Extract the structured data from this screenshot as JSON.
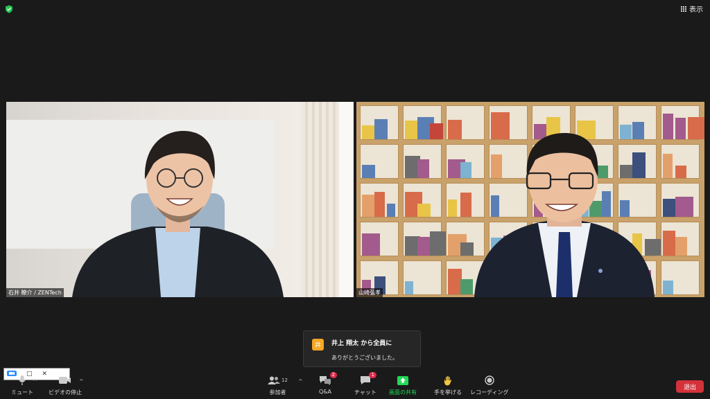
{
  "header": {
    "view_label": "表示"
  },
  "participants": [
    {
      "name": "石井 瞭介 / ZENTech"
    },
    {
      "name": "山崎弘孝"
    }
  ],
  "chat_popup": {
    "avatar_char": "井",
    "from_text": "井上 翔太 から全員に",
    "message": "ありがとうございました。"
  },
  "toolbar": {
    "mute_label": "ミュート",
    "video_label": "ビデオの停止",
    "participants_label": "参加者",
    "participants_count": "12",
    "qa_label": "Q&A",
    "qa_badge": "2",
    "chat_label": "チャット",
    "chat_badge": "1",
    "share_label": "画面の共有",
    "raise_hand_label": "手を挙げる",
    "record_label": "レコーディング",
    "leave_label": "退出"
  },
  "colors": {
    "leave": "#d3323b",
    "share": "#23d959",
    "shield": "#23c552",
    "badge": "#e0284a",
    "avatar": "#f5a623"
  }
}
